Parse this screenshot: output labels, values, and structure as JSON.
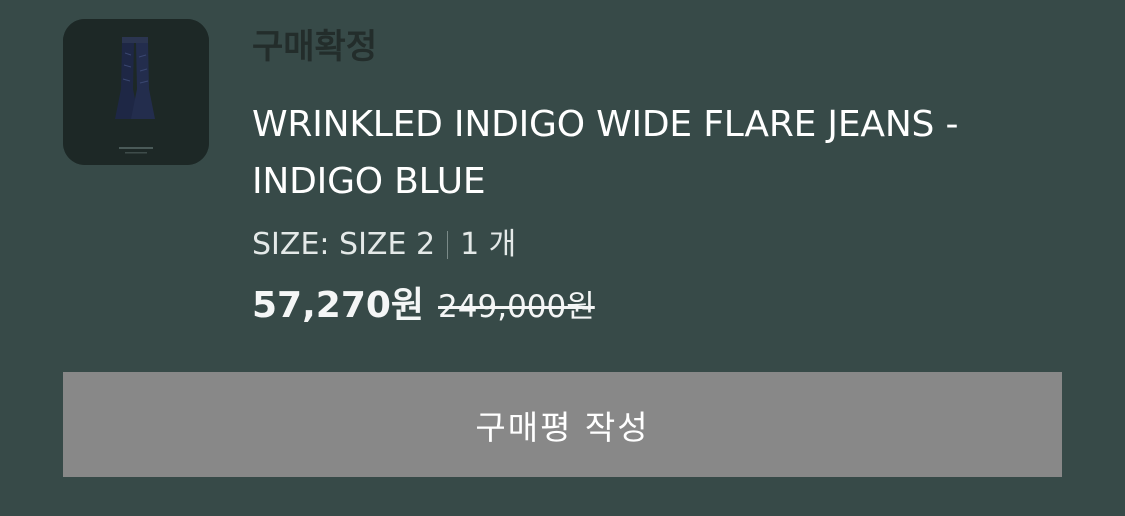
{
  "order": {
    "status": "구매확정",
    "product_name": "WRINKLED INDIGO WIDE FLARE JEANS - INDIGO BLUE",
    "option": "SIZE: SIZE 2",
    "quantity": "1 개",
    "sale_price": "57,270원",
    "original_price": "249,000원"
  },
  "actions": {
    "review_label": "구매평 작성"
  },
  "colors": {
    "background": "#374a48",
    "thumbnail_bg": "#1d2826",
    "status_text": "#232d2b",
    "button_bg": "#888888"
  },
  "icons": {
    "thumbnail": "jeans-product-image"
  }
}
